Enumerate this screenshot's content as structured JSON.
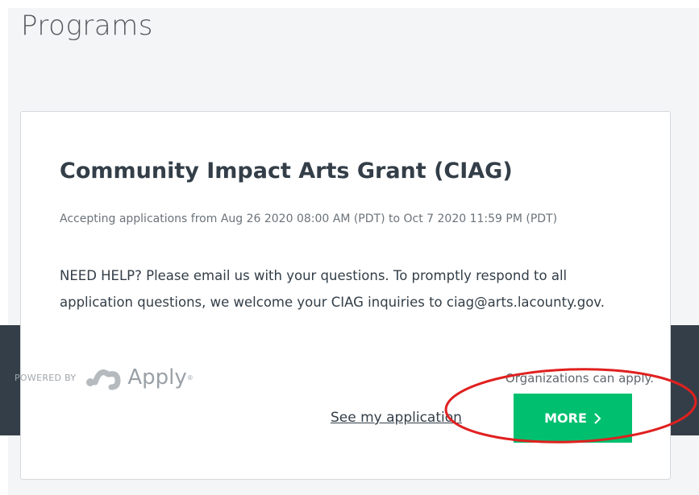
{
  "page": {
    "title": "Programs"
  },
  "program": {
    "title": "Community Impact Arts Grant (CIAG)",
    "dates": "Accepting applications from Aug 26 2020 08:00 AM (PDT) to Oct 7 2020 11:59 PM (PDT)",
    "description": "NEED HELP? Please email us with your questions. To promptly respond to all application questions, we welcome your CIAG inquiries to ciag@arts.lacounty.gov.",
    "eligibility": "Organizations can apply.",
    "see_application_label": "See my application",
    "more_label": "MORE"
  },
  "branding": {
    "powered_by": "POWERED BY",
    "product": "Apply",
    "trademark": "®"
  },
  "colors": {
    "accent": "#00bf6f",
    "annotation": "#e0201f",
    "band": "#333e48"
  }
}
